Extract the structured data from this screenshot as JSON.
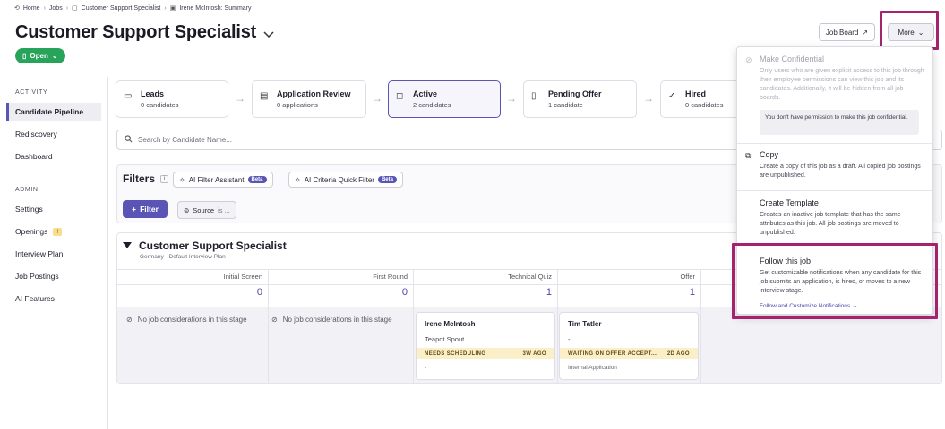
{
  "breadcrumb": {
    "items": [
      "Home",
      "Jobs",
      "Customer Support Specialist",
      "Irene McIntosh: Summary"
    ],
    "sep": "›"
  },
  "header": {
    "title": "Customer Support Specialist",
    "status": "Open",
    "job_board_label": "Job Board",
    "more_label": "More"
  },
  "sidebar": {
    "activity_heading": "ACTIVITY",
    "activity_items": [
      "Candidate Pipeline",
      "Rediscovery",
      "Dashboard"
    ],
    "admin_heading": "ADMIN",
    "admin_items": [
      "Settings",
      "Openings",
      "Interview Plan",
      "Job Postings",
      "AI Features"
    ],
    "openings_badge": "!"
  },
  "stages": [
    {
      "title": "Leads",
      "count": "0 candidates",
      "icon": "inbox-icon"
    },
    {
      "title": "Application Review",
      "count": "0 applications",
      "icon": "review-icon"
    },
    {
      "title": "Active",
      "count": "2 candidates",
      "icon": "chat-icon"
    },
    {
      "title": "Pending Offer",
      "count": "1 candidate",
      "icon": "document-icon"
    },
    {
      "title": "Hired",
      "count": "0 candidates",
      "icon": "user-check-icon"
    }
  ],
  "search": {
    "placeholder": "Search by Candidate Name..."
  },
  "filters": {
    "label": "Filters",
    "info": "i",
    "ai_filter_label": "AI Filter Assistant",
    "ai_criteria_label": "AI Criteria Quick Filter",
    "beta": "Beta",
    "filter_button": "Filter",
    "source_chip": "Source",
    "source_chip_suffix": "is ..."
  },
  "plan": {
    "title": "Customer Support Specialist",
    "subtitle": "Germany - Default Interview Plan",
    "columns": [
      {
        "name": "Initial Screen",
        "count": "0"
      },
      {
        "name": "First Round",
        "count": "0"
      },
      {
        "name": "Technical Quiz",
        "count": "1"
      },
      {
        "name": "Offer",
        "count": "1"
      }
    ],
    "empty_text": "No job considerations in this stage",
    "cards": [
      {
        "name": "Irene McIntosh",
        "meta": "Teapot Spout",
        "status": "NEEDS SCHEDULING",
        "age": "3W AGO",
        "foot": "-"
      },
      {
        "name": "Tim Tatler",
        "meta": "-",
        "status": "WAITING ON OFFER ACCEPT...",
        "age": "2D AGO",
        "foot": "Internal Application"
      }
    ]
  },
  "menu": {
    "confidential_title": "Make Confidential",
    "confidential_desc": "Only users who are given explicit access to this job through their employee permissions can view this job and its candidates. Additionally, it will be hidden from all job boards.",
    "permission_note": "You don't have permission to make this job confidential.",
    "copy_title": "Copy",
    "copy_desc": "Create a copy of this job as a draft. All copied job postings are unpublished.",
    "template_title": "Create Template",
    "template_desc": "Creates an inactive job template that has the same attributes as this job. All job postings are moved to unpublished.",
    "follow_title": "Follow this job",
    "follow_desc": "Get customizable notifications when any candidate for this job submits an application, is hired, or moves to a new interview stage.",
    "follow_link": "Follow and Customize Notifications →"
  },
  "colors": {
    "accent": "#5a55b5",
    "open_green": "#27a35a",
    "highlight": "#a3246d"
  }
}
